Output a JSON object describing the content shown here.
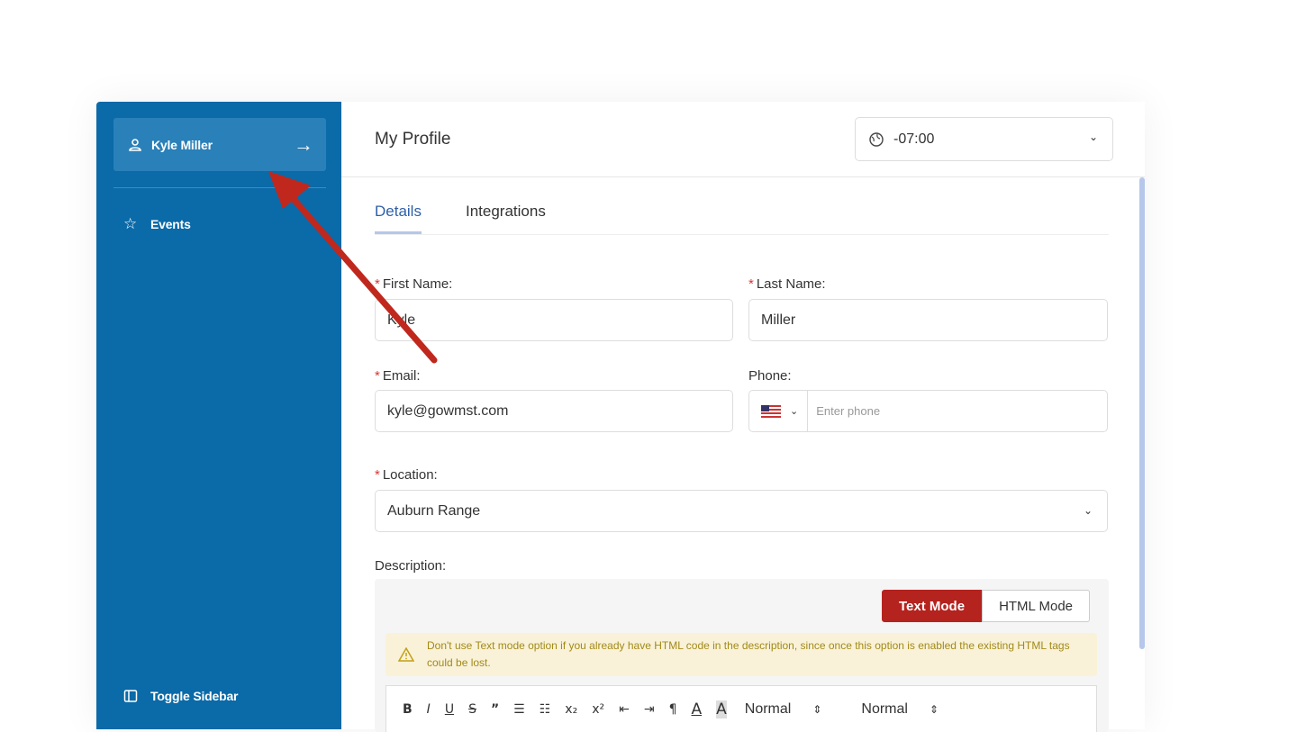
{
  "sidebar": {
    "user_label": "Kyle Miller",
    "events_label": "Events",
    "toggle_label": "Toggle Sidebar"
  },
  "header": {
    "title": "My Profile",
    "timezone": "-07:00"
  },
  "tabs": [
    {
      "label": "Details"
    },
    {
      "label": "Integrations"
    }
  ],
  "form": {
    "first_name": {
      "label": "First Name:",
      "value": "Kyle"
    },
    "last_name": {
      "label": "Last Name:",
      "value": "Miller"
    },
    "email": {
      "label": "Email:",
      "value": "kyle@gowmst.com"
    },
    "phone": {
      "label": "Phone:",
      "placeholder": "Enter phone"
    },
    "location": {
      "label": "Location:",
      "value": "Auburn Range"
    },
    "description": {
      "label": "Description:"
    }
  },
  "editor": {
    "text_mode_label": "Text Mode",
    "html_mode_label": "HTML Mode",
    "warning": "Don't use Text mode option if you already have HTML code in the description, since once this option is enabled the existing HTML tags could be lost.",
    "toolbar": {
      "bold": "B",
      "italic": "I",
      "underline": "U",
      "strike": "S",
      "quote": "”",
      "subscript": "x₂",
      "superscript": "x²",
      "heading_select": "Normal",
      "size_select": "Normal"
    }
  },
  "colors": {
    "sidebar": "#0b6aa8",
    "sidebar_active": "#2a80b8",
    "text_mode_active": "#b5231f",
    "tab_active": "#2f5fa8",
    "annotation_arrow": "#c0281e"
  }
}
